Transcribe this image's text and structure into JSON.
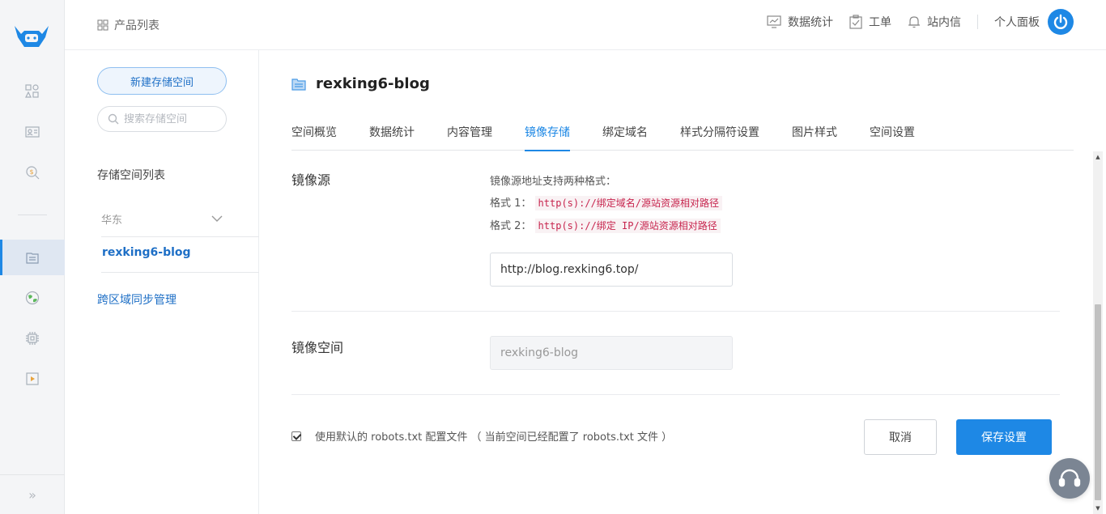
{
  "header": {
    "breadcrumb": "产品列表",
    "nav": [
      {
        "label": "数据统计",
        "icon": "chart-icon"
      },
      {
        "label": "工单",
        "icon": "clipboard-icon"
      },
      {
        "label": "站内信",
        "icon": "bell-icon"
      }
    ],
    "user_panel": "个人面板"
  },
  "rail": {
    "items": [
      "grid-icon",
      "id-card-icon",
      "dollar-search-icon",
      "storage-icon",
      "globe-icon",
      "chip-icon",
      "media-icon"
    ],
    "active": "storage-icon",
    "collapse": "»"
  },
  "panel": {
    "new_bucket": "新建存储空间",
    "search_placeholder": "搜索存储空间",
    "list_title": "存储空间列表",
    "region": "华东",
    "bucket": "rexking6-blog",
    "cross_region": "跨区域同步管理"
  },
  "main": {
    "bucket_title": "rexking6-blog",
    "tabs": [
      "空间概览",
      "数据统计",
      "内容管理",
      "镜像存储",
      "绑定域名",
      "样式分隔符设置",
      "图片样式",
      "空间设置"
    ],
    "active_tab": "镜像存储",
    "mirror_source": {
      "label": "镜像源",
      "desc_title": "镜像源地址支持两种格式：",
      "format1_label": "格式 1：",
      "format1_code": "http(s)://绑定域名/源站资源相对路径",
      "format2_label": "格式 2：",
      "format2_code": "http(s)://绑定 IP/源站资源相对路径",
      "value": "http://blog.rexking6.top/"
    },
    "mirror_space": {
      "label": "镜像空间",
      "value": "rexking6-blog"
    },
    "robots_checkbox": {
      "checked": true,
      "label": "使用默认的 robots.txt 配置文件 （ 当前空间已经配置了 robots.txt 文件 ）"
    },
    "cancel": "取消",
    "save": "保存设置"
  },
  "colors": {
    "accent": "#1e88e5",
    "code_text": "#c7254e",
    "code_bg": "#f9f2f4"
  }
}
